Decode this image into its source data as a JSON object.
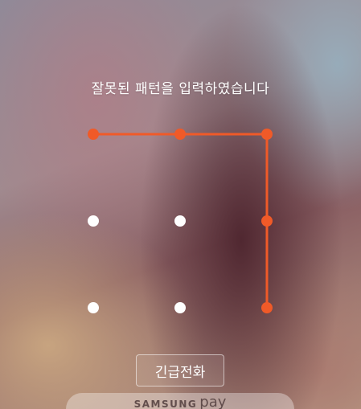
{
  "lockscreen": {
    "message": "잘못된 패턴을 입력하였습니다",
    "emergency_call_label": "긴급전화",
    "samsung_pay": {
      "brand": "SAMSUNG",
      "product": "pay"
    }
  },
  "pattern": {
    "grid": "3x3",
    "selected_sequence": [
      1,
      2,
      3,
      6,
      9
    ],
    "colors": {
      "selected": "#f05a28",
      "idle": "#ffffff"
    }
  }
}
